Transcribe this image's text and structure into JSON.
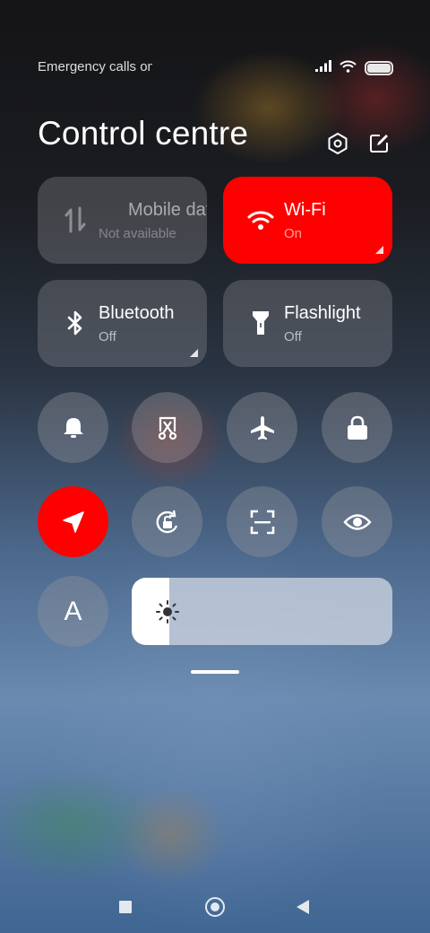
{
  "status_bar": {
    "carrier_text": "Emergency calls only",
    "icons": [
      "signal-icon",
      "wifi-icon",
      "battery-icon"
    ]
  },
  "header": {
    "title": "Control centre",
    "settings_icon": "settings-hexagon-icon",
    "edit_icon": "edit-icon"
  },
  "tiles": [
    {
      "label": "Mobile data",
      "status": "Not available",
      "icon": "mobile-data-icon",
      "state": "unavailable"
    },
    {
      "label": "Wi-Fi",
      "status": "On",
      "icon": "wifi-icon",
      "state": "on"
    },
    {
      "label": "Bluetooth",
      "status": "Off",
      "icon": "bluetooth-icon",
      "state": "off"
    },
    {
      "label": "Flashlight",
      "status": "Off",
      "icon": "flashlight-icon",
      "state": "off"
    }
  ],
  "toggles": [
    {
      "name": "sound",
      "icon": "bell-icon",
      "active": false
    },
    {
      "name": "screenshot",
      "icon": "scissors-screenshot-icon",
      "active": false
    },
    {
      "name": "airplane-mode",
      "icon": "airplane-icon",
      "active": false
    },
    {
      "name": "lock-screen",
      "icon": "lock-icon",
      "active": false
    },
    {
      "name": "location",
      "icon": "location-arrow-icon",
      "active": true
    },
    {
      "name": "auto-rotate",
      "icon": "rotation-lock-icon",
      "active": false
    },
    {
      "name": "scanner",
      "icon": "scan-icon",
      "active": false
    },
    {
      "name": "reading-mode",
      "icon": "eye-icon",
      "active": false
    },
    {
      "name": "auto-brightness",
      "icon": "letter-a-icon",
      "label": "A",
      "active": false
    }
  ],
  "brightness": {
    "level": 0.145,
    "icon": "sun-icon"
  },
  "nav_bar": {
    "icons": [
      "recents-square-icon",
      "home-circle-icon",
      "back-triangle-icon"
    ]
  },
  "colors": {
    "accent_active": "#fe0000",
    "tile_inactive": "rgba(150,150,155,0.32)"
  }
}
